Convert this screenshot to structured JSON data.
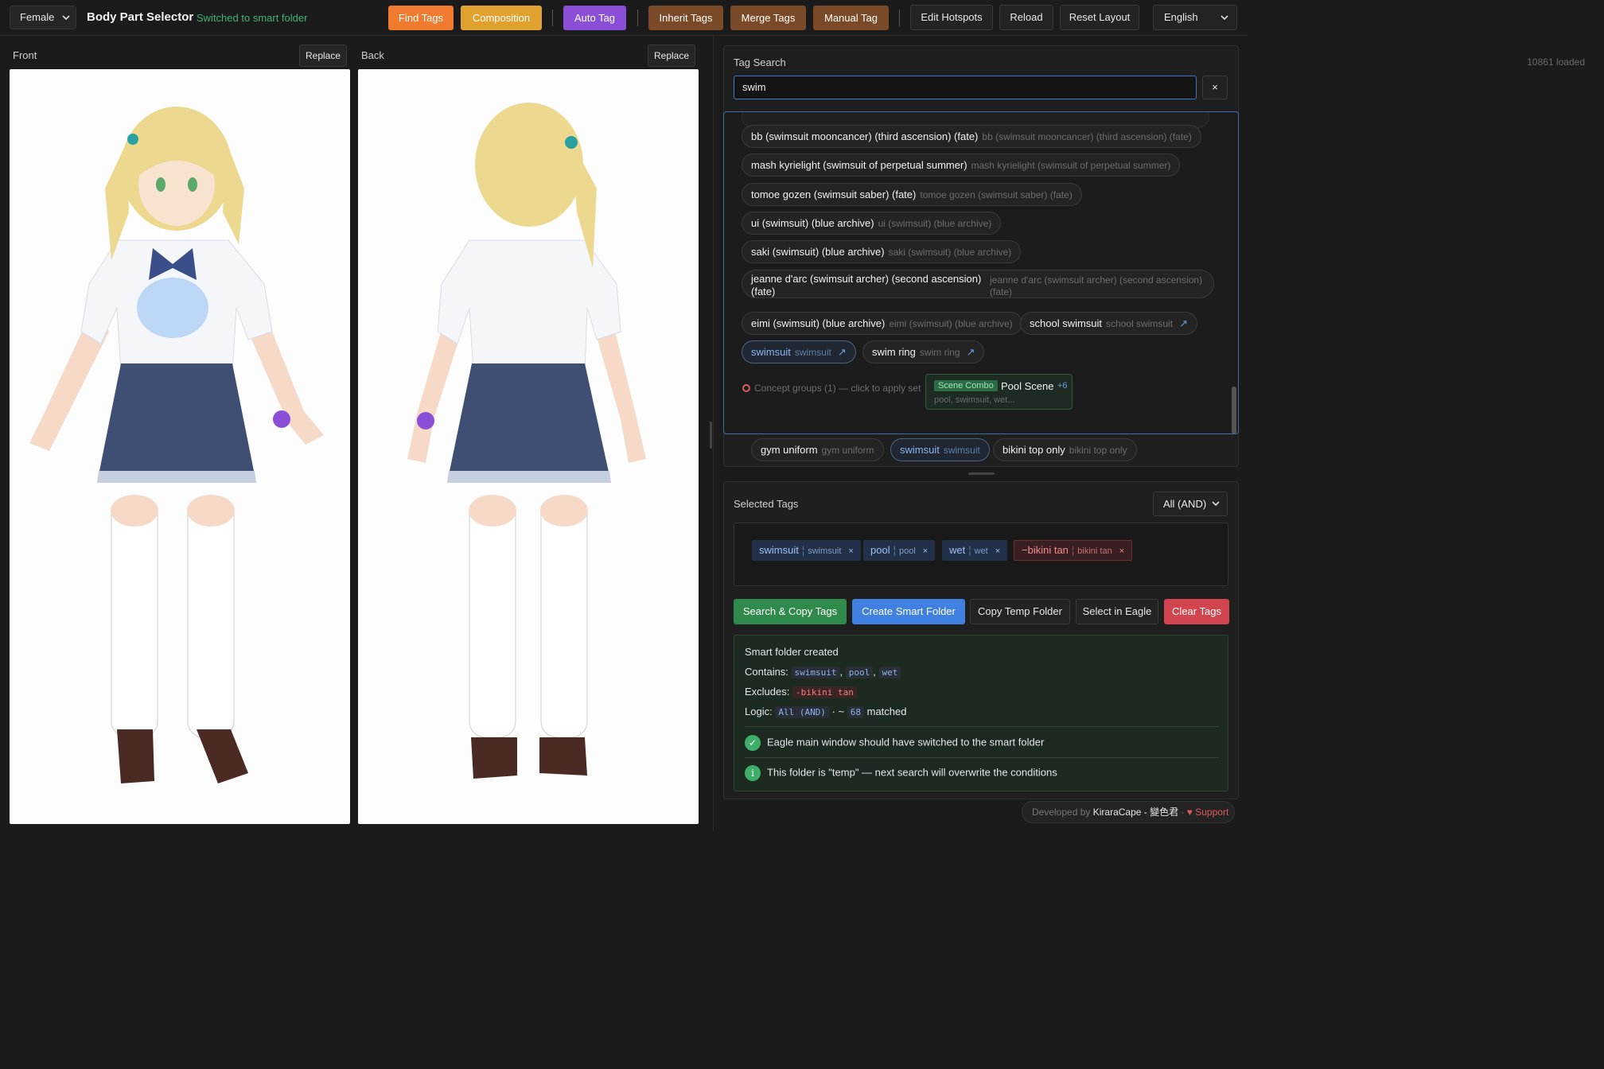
{
  "topbar": {
    "gender_value": "Female",
    "title": "Body Part Selector",
    "status": "Switched to smart folder",
    "actions": [
      {
        "label": "Find Tags",
        "color": "#f07a2e"
      },
      {
        "label": "Composition",
        "color": "#e0a12e"
      },
      {
        "label": "Auto Tag",
        "color": "#8a4fd6"
      },
      {
        "label": "Inherit Tags",
        "color": "#7a4a28"
      },
      {
        "label": "Merge Tags",
        "color": "#7a4a28"
      },
      {
        "label": "Manual Tag",
        "color": "#7a4a28"
      }
    ],
    "tools": [
      "Edit Hotspots",
      "Reload",
      "Reset Layout"
    ],
    "language": "English"
  },
  "views": {
    "front_label": "Front",
    "back_label": "Back",
    "replace_label": "Replace"
  },
  "tag_search": {
    "title": "Tag Search",
    "loaded": "10861 loaded",
    "query": "swim",
    "clear": "×",
    "results": [
      {
        "name": "bb (swimsuit mooncancer) (third ascension) (fate)",
        "alias": "bb (swimsuit mooncancer) (third ascension) (fate)"
      },
      {
        "name": "mash kyrielight (swimsuit of perpetual summer)",
        "alias": "mash kyrielight (swimsuit of perpetual summer)"
      },
      {
        "name": "tomoe gozen (swimsuit saber) (fate)",
        "alias": "tomoe gozen (swimsuit saber) (fate)"
      },
      {
        "name": "ui (swimsuit) (blue archive)",
        "alias": "ui (swimsuit) (blue archive)"
      },
      {
        "name": "saki (swimsuit) (blue archive)",
        "alias": "saki (swimsuit) (blue archive)"
      },
      {
        "name": "jeanne d'arc (swimsuit archer) (second ascension) (fate)",
        "alias": "jeanne d'arc (swimsuit archer) (second ascension) (fate)"
      },
      {
        "name": "eimi (swimsuit) (blue archive)",
        "alias": "eimi (swimsuit) (blue archive)"
      },
      {
        "name": "school swimsuit",
        "alias": "school swimsuit",
        "arrow": "↗"
      },
      {
        "name": "swimsuit",
        "alias": "swimsuit",
        "arrow": "↗"
      },
      {
        "name": "swim ring",
        "alias": "swim ring",
        "arrow": "↗"
      }
    ],
    "concept_groups": "Concept groups (1) — click to apply set",
    "combo": {
      "badge": "Scene Combo",
      "name": "Pool Scene",
      "more": "+6",
      "sub": "pool, swimsuit, wet..."
    },
    "suggestions": [
      {
        "name": "gym uniform",
        "alias": "gym uniform"
      },
      {
        "name": "swimsuit",
        "alias": "swimsuit"
      },
      {
        "name": "bikini top only",
        "alias": "bikini top only"
      }
    ]
  },
  "selected": {
    "title": "Selected Tags",
    "logic": "All (AND)",
    "tags": [
      {
        "name": "swimsuit",
        "alias": "swimsuit",
        "remove": "×"
      },
      {
        "name": "pool",
        "alias": "pool",
        "remove": "×"
      },
      {
        "name": "wet",
        "alias": "wet",
        "remove": "×"
      },
      {
        "name": "−bikini tan",
        "alias": "bikini tan",
        "remove": "×"
      }
    ],
    "buttons": {
      "search_copy": "Search & Copy Tags",
      "create_smart": "Create Smart Folder",
      "copy_temp": "Copy Temp Folder",
      "select_eagle": "Select in Eagle",
      "clear": "Clear Tags"
    }
  },
  "result": {
    "heading": "Smart folder created",
    "contains_label": "Contains:",
    "contains": [
      "swimsuit",
      "pool",
      "wet"
    ],
    "excludes_label": "Excludes:",
    "excludes": "-bikini tan",
    "logic_label": "Logic:",
    "logic_value": "All (AND)",
    "approx": "· ~",
    "count": "68",
    "matched": "matched",
    "note_ok": "Eagle main window should have switched to the smart folder",
    "note_info": "This folder is \"temp\" — next search will overwrite the conditions",
    "ok_icon": "✓",
    "info_icon": "i"
  },
  "footer": {
    "developed_by": "Developed by",
    "author": "KiraraCape - 變色君",
    "support": "♥ Support",
    "separator": "·"
  }
}
